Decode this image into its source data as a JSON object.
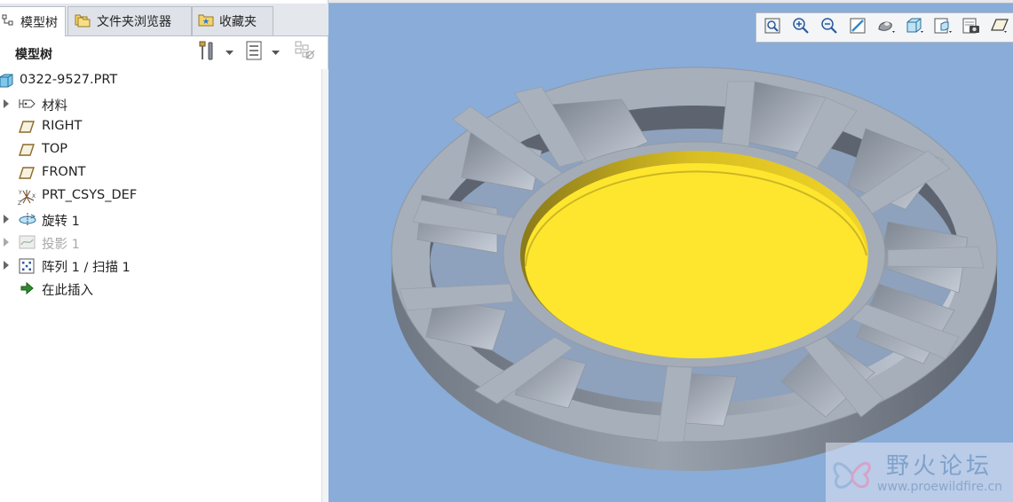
{
  "tabs": [
    {
      "label": "模型树",
      "icon": "model-tree-icon",
      "active": true
    },
    {
      "label": "文件夹浏览器",
      "icon": "folder-browser-icon",
      "active": false
    },
    {
      "label": "收藏夹",
      "icon": "favorites-icon",
      "active": false
    }
  ],
  "panel": {
    "title": "模型树",
    "settings_icon": "tools-icon",
    "show_icon": "tree-list-icon",
    "filter_icon": "filter-icon"
  },
  "tree": [
    {
      "label": "0322-9527.PRT",
      "icon": "part-icon",
      "expander": false,
      "disabled": false
    },
    {
      "label": "材料",
      "icon": "material-icon",
      "expander": true,
      "disabled": false
    },
    {
      "label": "RIGHT",
      "icon": "datum-plane-icon",
      "expander": false,
      "disabled": false
    },
    {
      "label": "TOP",
      "icon": "datum-plane-icon",
      "expander": false,
      "disabled": false
    },
    {
      "label": "FRONT",
      "icon": "datum-plane-icon",
      "expander": false,
      "disabled": false
    },
    {
      "label": "PRT_CSYS_DEF",
      "icon": "coordinate-system-icon",
      "expander": false,
      "disabled": false
    },
    {
      "label": "旋转 1",
      "icon": "revolve-icon",
      "expander": true,
      "disabled": false
    },
    {
      "label": "投影 1",
      "icon": "projection-icon",
      "expander": true,
      "disabled": true
    },
    {
      "label": "阵列 1 / 扫描 1",
      "icon": "pattern-icon",
      "expander": true,
      "disabled": false
    },
    {
      "label": "在此插入",
      "icon": "insert-arrow-icon",
      "expander": false,
      "disabled": false
    }
  ],
  "view_toolbar": [
    "refit-icon",
    "zoom-in-icon",
    "zoom-out-icon",
    "repaint-icon",
    "display-style-icon",
    "saved-orientations-icon",
    "saved-views-icon",
    "view-manager-icon",
    "datum-display-icon"
  ],
  "colors": {
    "viewport_bg": "#89acd8",
    "part_gray": "#a7afbb",
    "selected_face": "#ffe12e"
  },
  "watermark": {
    "title": "野火论坛",
    "url": "www.proewildfire.cn"
  }
}
